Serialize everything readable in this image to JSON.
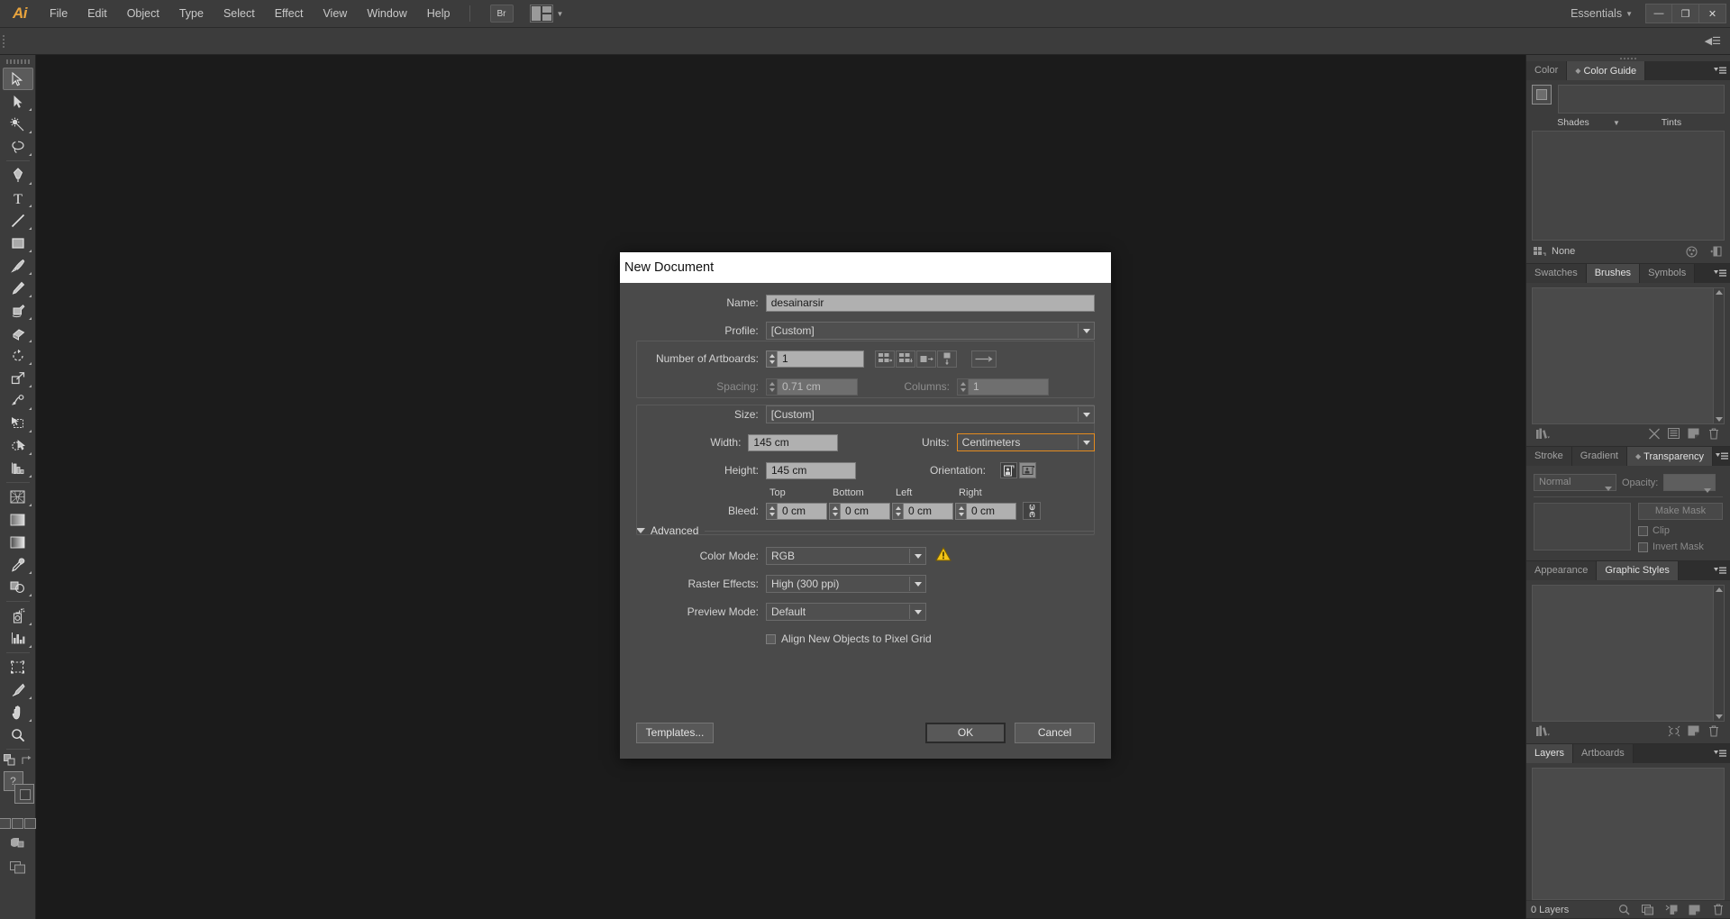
{
  "app": {
    "logo": "Ai",
    "workspace": "Essentials",
    "menus": [
      "File",
      "Edit",
      "Object",
      "Type",
      "Select",
      "Effect",
      "View",
      "Window",
      "Help"
    ],
    "bridge_button": "Br",
    "window_buttons": {
      "minimize": "—",
      "restore": "❐",
      "close": "✕"
    }
  },
  "toolbar": {
    "tools": [
      "selection-tool",
      "direct-selection-tool",
      "magic-wand-tool",
      "lasso-tool",
      "pen-tool",
      "type-tool",
      "line-segment-tool",
      "rectangle-tool",
      "paintbrush-tool",
      "pencil-tool",
      "blob-brush-tool",
      "eraser-tool",
      "rotate-tool",
      "scale-tool",
      "width-tool",
      "free-transform-tool",
      "shape-builder-tool",
      "perspective-grid-tool",
      "mesh-tool",
      "gradient-tool",
      "eyedropper-tool",
      "blend-tool",
      "symbol-sprayer-tool",
      "column-graph-tool",
      "artboard-tool",
      "slice-tool",
      "hand-tool",
      "zoom-tool"
    ],
    "fill_none_indicator": "?"
  },
  "panels": {
    "color_guide": {
      "tabs": [
        {
          "label": "Color",
          "active": false
        },
        {
          "label": "Color Guide",
          "active": true
        }
      ],
      "shades_label": "Shades",
      "tints_label": "Tints",
      "status": "None"
    },
    "brushes": {
      "tabs": [
        {
          "label": "Swatches",
          "active": false
        },
        {
          "label": "Brushes",
          "active": true
        },
        {
          "label": "Symbols",
          "active": false
        }
      ]
    },
    "transparency": {
      "tabs": [
        {
          "label": "Stroke",
          "active": false
        },
        {
          "label": "Gradient",
          "active": false
        },
        {
          "label": "Transparency",
          "active": true
        }
      ],
      "blend_mode": "Normal",
      "opacity_label": "Opacity:",
      "make_mask": "Make Mask",
      "clip": "Clip",
      "invert_mask": "Invert Mask"
    },
    "graphic_styles": {
      "tabs": [
        {
          "label": "Appearance",
          "active": false
        },
        {
          "label": "Graphic Styles",
          "active": true
        }
      ]
    },
    "layers": {
      "tabs": [
        {
          "label": "Layers",
          "active": true
        },
        {
          "label": "Artboards",
          "active": false
        }
      ],
      "count_label": "0 Layers"
    }
  },
  "dialog": {
    "title": "New Document",
    "name": {
      "label": "Name:",
      "value": "desainarsir"
    },
    "profile": {
      "label": "Profile:",
      "value": "[Custom]"
    },
    "artboards": {
      "label": "Number of Artboards:",
      "value": "1",
      "spacing_label": "Spacing:",
      "spacing_value": "0.71 cm",
      "columns_label": "Columns:",
      "columns_value": "1"
    },
    "size": {
      "label": "Size:",
      "value": "[Custom]"
    },
    "width": {
      "label": "Width:",
      "value": "145 cm"
    },
    "height": {
      "label": "Height:",
      "value": "145 cm"
    },
    "units": {
      "label": "Units:",
      "value": "Centimeters"
    },
    "orientation": {
      "label": "Orientation:"
    },
    "bleed": {
      "label": "Bleed:",
      "top_label": "Top",
      "top_value": "0 cm",
      "bottom_label": "Bottom",
      "bottom_value": "0 cm",
      "left_label": "Left",
      "left_value": "0 cm",
      "right_label": "Right",
      "right_value": "0 cm"
    },
    "advanced": {
      "label": "Advanced",
      "color_mode": {
        "label": "Color Mode:",
        "value": "RGB"
      },
      "raster_effects": {
        "label": "Raster Effects:",
        "value": "High (300 ppi)"
      },
      "preview_mode": {
        "label": "Preview Mode:",
        "value": "Default"
      },
      "align_pixel_grid": {
        "label": "Align New Objects to Pixel Grid",
        "checked": false
      }
    },
    "buttons": {
      "templates": "Templates...",
      "ok": "OK",
      "cancel": "Cancel"
    }
  },
  "colors": {
    "accent_orange": "#e38b1f",
    "warning_yellow": "#f2c316",
    "panel_bg": "#3c3c3c",
    "dialog_bg": "#4a4a4a",
    "canvas_bg": "#1b1b1b"
  }
}
